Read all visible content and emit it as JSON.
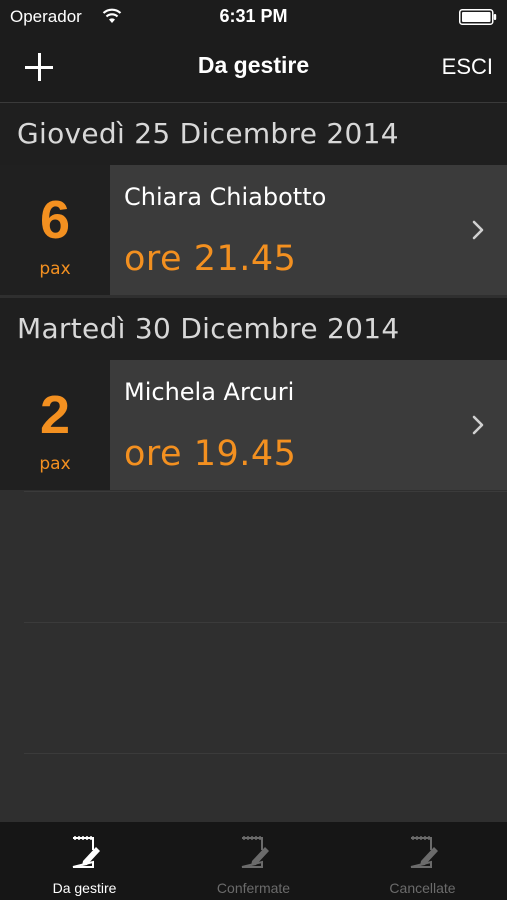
{
  "status_bar": {
    "carrier": "Operador",
    "time": "6:31 PM",
    "wifi_icon": "wifi-icon",
    "battery_icon": "battery-icon"
  },
  "nav_bar": {
    "left_icon": "plus-icon",
    "title": "Da gestire",
    "right_label": "ESCI"
  },
  "sections": [
    {
      "date": "Giovedì 25 Dicembre 2014",
      "bookings": [
        {
          "pax": "6",
          "pax_label": "pax",
          "name": "Chiara Chiabotto",
          "time": "ore 21.45"
        }
      ]
    },
    {
      "date": "Martedì 30 Dicembre 2014",
      "bookings": [
        {
          "pax": "2",
          "pax_label": "pax",
          "name": "Michela Arcuri",
          "time": "ore 19.45"
        }
      ]
    }
  ],
  "tabs": [
    {
      "label": "Da gestire",
      "icon": "edit-note-icon",
      "active": true
    },
    {
      "label": "Confermate",
      "icon": "edit-note-icon",
      "active": false
    },
    {
      "label": "Cancellate",
      "icon": "edit-note-icon",
      "active": false
    }
  ],
  "colors": {
    "accent": "#f39020",
    "background": "#2f2f2f",
    "bar": "#1c1c1c",
    "tab_active": "#ffffff",
    "tab_inactive": "#6b6b6b"
  }
}
